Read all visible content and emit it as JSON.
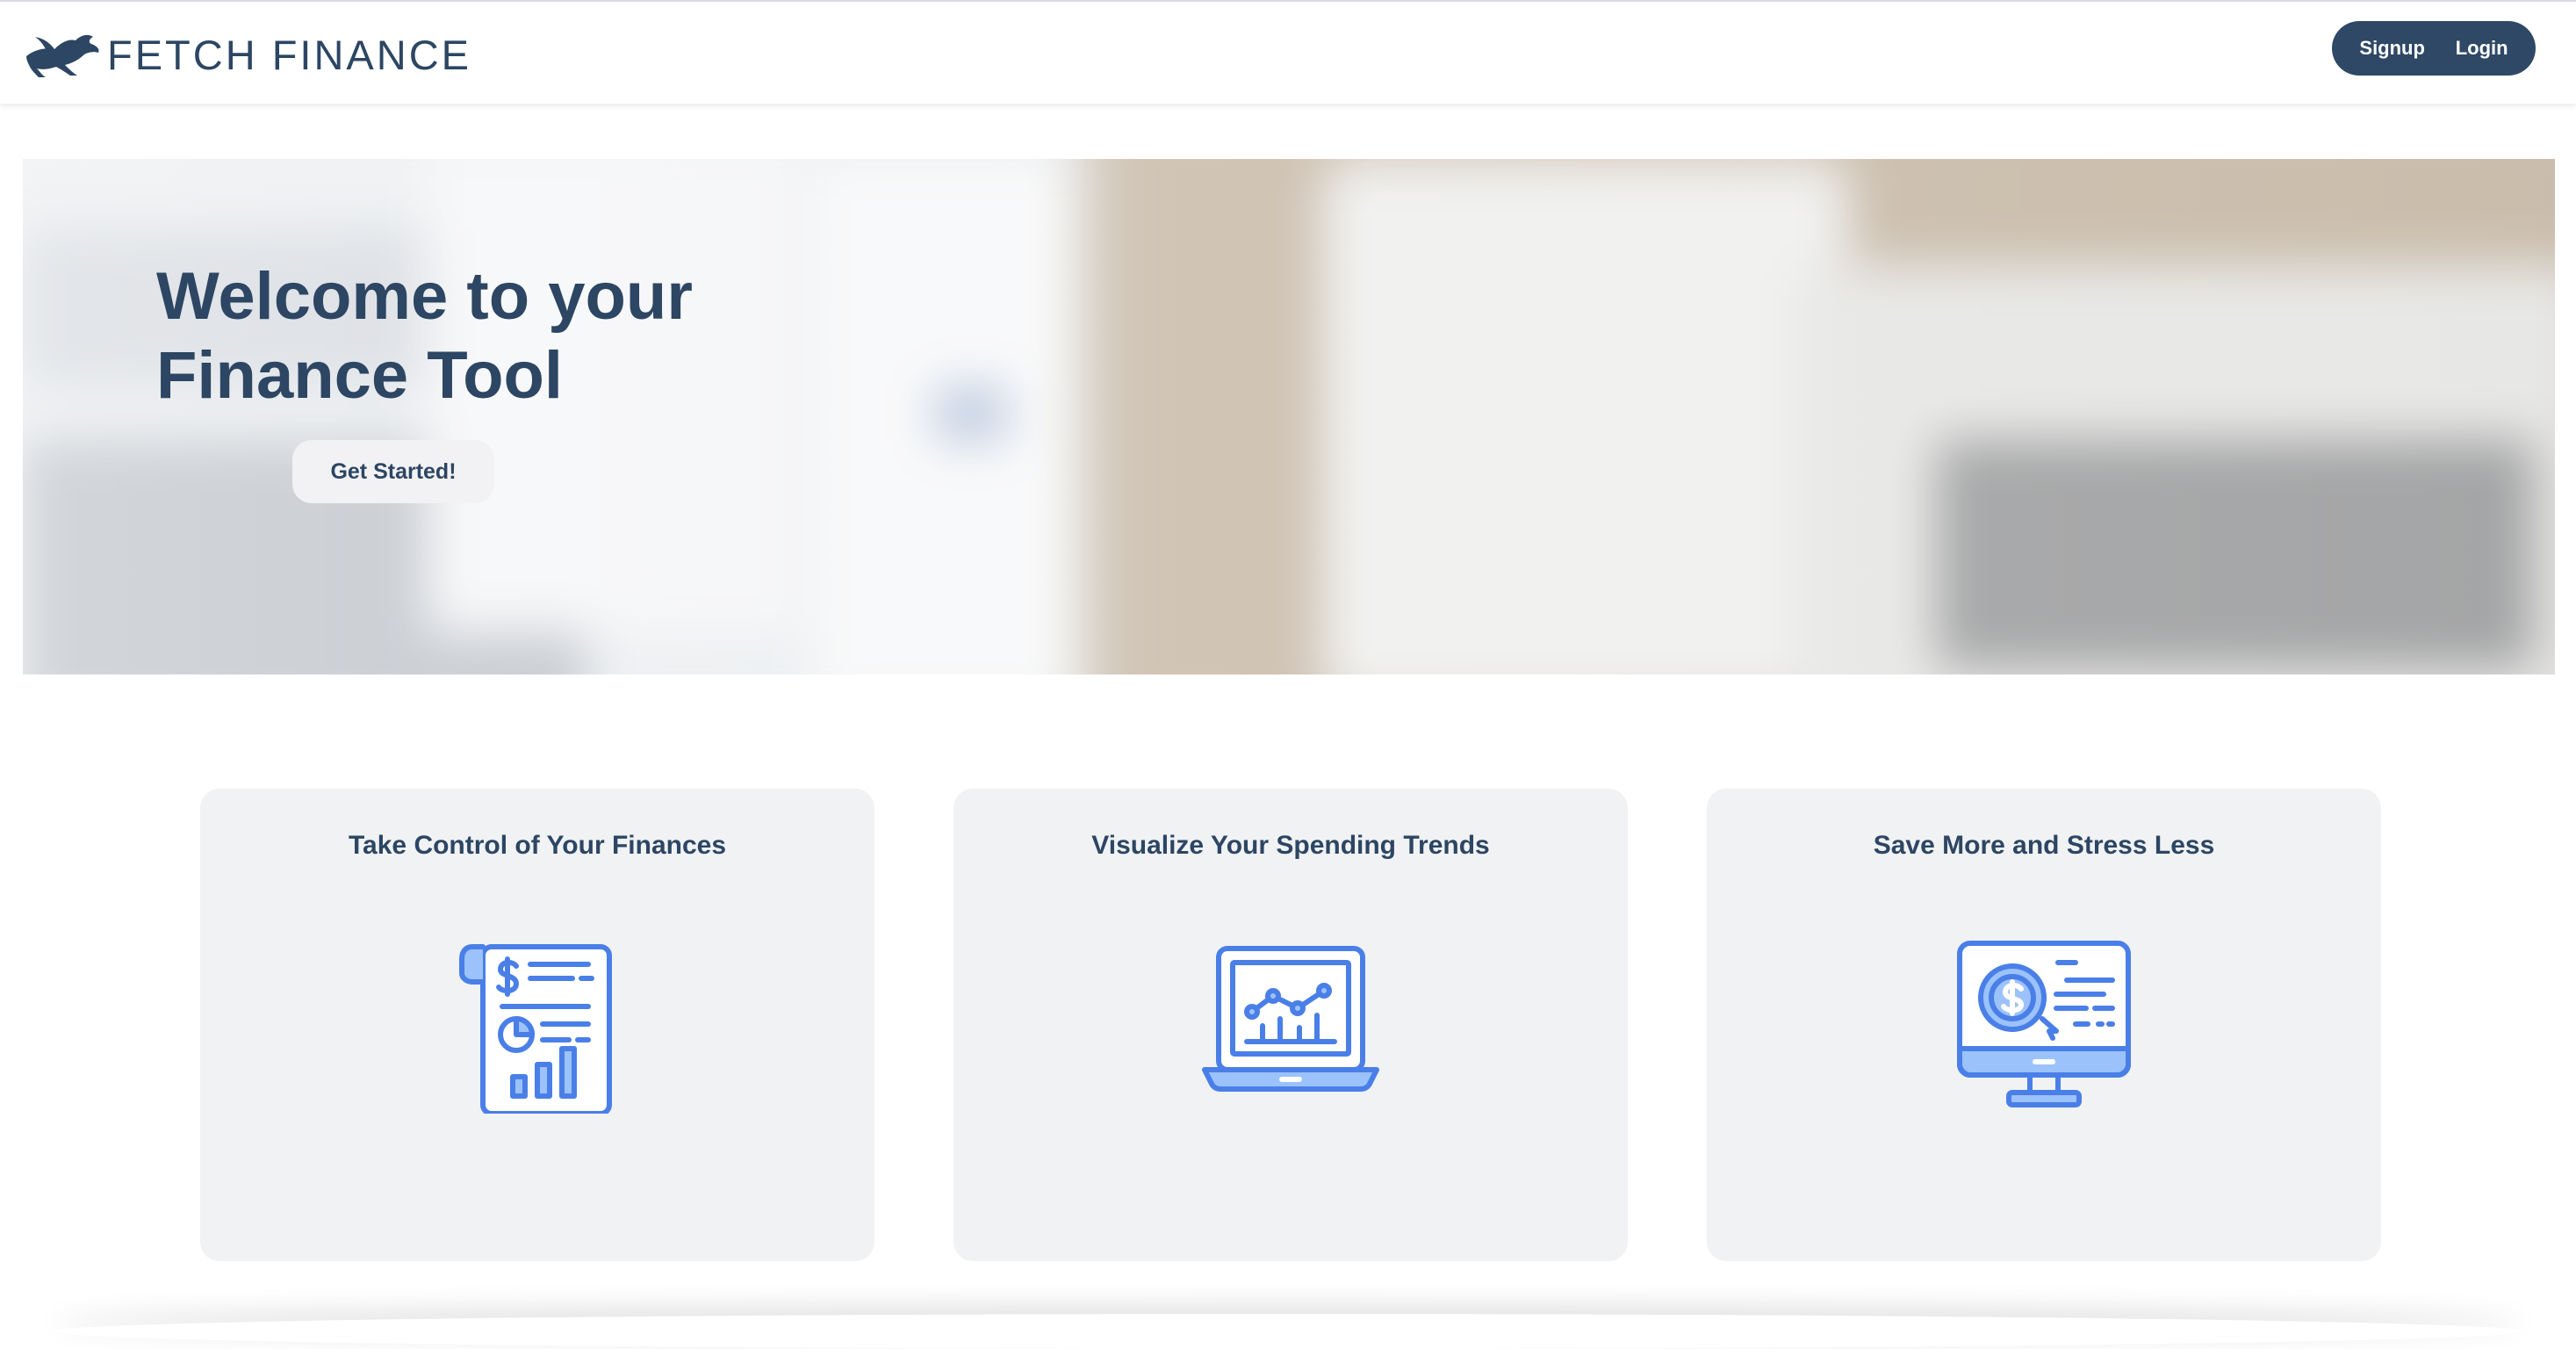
{
  "brand": {
    "name": "FETCH FINANCE",
    "logo_icon": "leaping-dog-icon"
  },
  "nav": {
    "signup_label": "Signup",
    "login_label": "Login"
  },
  "hero": {
    "title_line1": "Welcome to your",
    "title_line2": "Finance Tool",
    "cta_label": "Get Started!"
  },
  "features": [
    {
      "title": "Take Control of Your Finances",
      "icon": "financial-report-icon"
    },
    {
      "title": "Visualize Your Spending Trends",
      "icon": "laptop-chart-icon"
    },
    {
      "title": "Save More and Stress Less",
      "icon": "monitor-dollar-icon"
    }
  ],
  "colors": {
    "brand_navy": "#2c4663",
    "pill_bg": "#2e4866",
    "card_bg": "#f1f2f4",
    "icon_blue": "#4a7fe8",
    "icon_fill": "#9cc2fb"
  }
}
